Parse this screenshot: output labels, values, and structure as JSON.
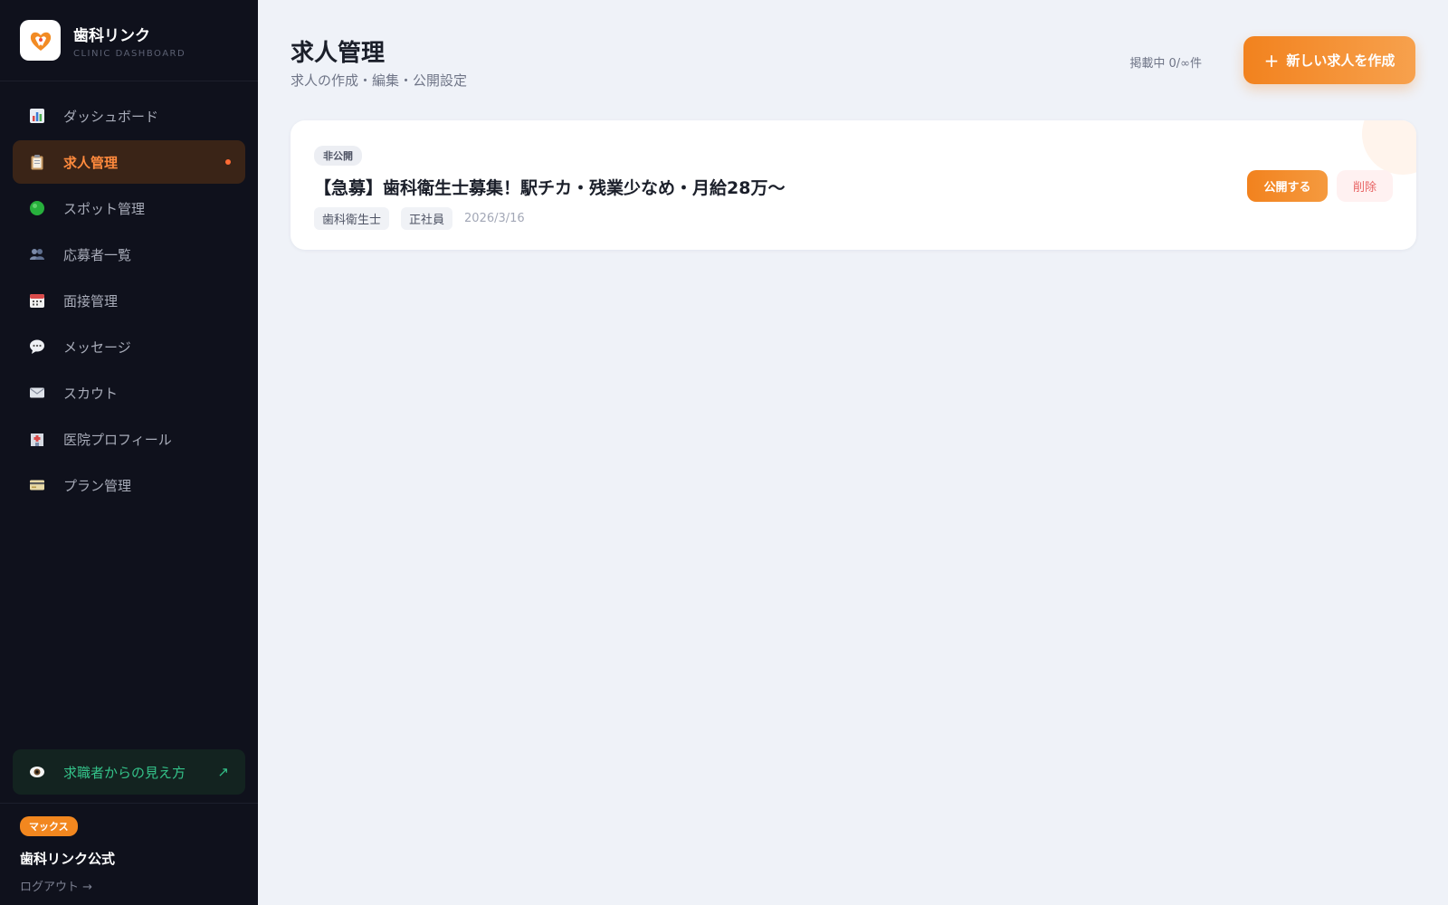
{
  "brand": {
    "name": "歯科リンク",
    "subtitle": "CLINIC DASHBOARD"
  },
  "sidebar": {
    "items": [
      {
        "label": "ダッシュボード",
        "icon": "bar-chart-icon",
        "active": false
      },
      {
        "label": "求人管理",
        "icon": "clipboard-icon",
        "active": true
      },
      {
        "label": "スポット管理",
        "icon": "green-circle-icon",
        "active": false
      },
      {
        "label": "応募者一覧",
        "icon": "people-icon",
        "active": false
      },
      {
        "label": "面接管理",
        "icon": "calendar-icon",
        "active": false
      },
      {
        "label": "メッセージ",
        "icon": "speech-bubble-icon",
        "active": false
      },
      {
        "label": "スカウト",
        "icon": "envelope-icon",
        "active": false
      },
      {
        "label": "医院プロフィール",
        "icon": "hospital-icon",
        "active": false
      },
      {
        "label": "プラン管理",
        "icon": "credit-card-icon",
        "active": false
      }
    ],
    "preview_link": {
      "label": "求職者からの見え方",
      "arrow": "↗",
      "icon": "eye-icon"
    },
    "account": {
      "plan_badge": "マックス",
      "name": "歯科リンク公式",
      "logout": "ログアウト →"
    }
  },
  "main": {
    "title": "求人管理",
    "subtitle": "求人の作成・編集・公開設定",
    "listing_count": "掲載中 0/∞件",
    "create_button": {
      "plus": "+",
      "label": "新しい求人を作成"
    },
    "jobs": [
      {
        "status": "非公開",
        "title": "【急募】歯科衛生士募集！駅チカ・残業少なめ・月給28万〜",
        "tags": [
          "歯科衛生士",
          "正社員"
        ],
        "date": "2026/3/16",
        "publish_label": "公開する",
        "delete_label": "削除"
      }
    ]
  },
  "colors": {
    "accent": "#f2821e",
    "sidebar_bg": "#0f111c",
    "active_bg": "#3a2417",
    "active_text": "#ff8a3d",
    "preview_text": "#34c38a",
    "delete_text": "#e86565"
  }
}
